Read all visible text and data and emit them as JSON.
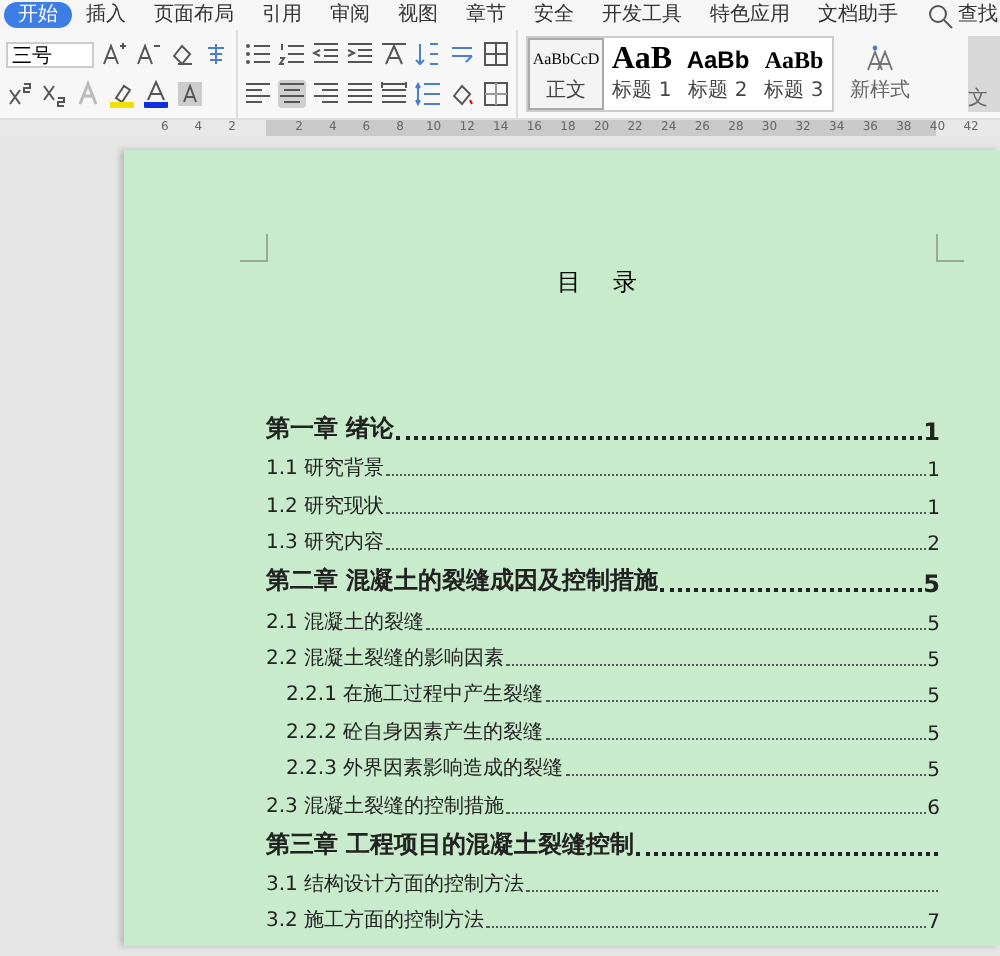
{
  "menu_tabs": [
    {
      "label": "开始",
      "selected": true,
      "kind": "tab"
    },
    {
      "label": "插入",
      "selected": false,
      "kind": "tab"
    },
    {
      "label": "页面布局",
      "selected": false,
      "kind": "tab"
    },
    {
      "label": "引用",
      "selected": false,
      "kind": "tab"
    },
    {
      "label": "审阅",
      "selected": false,
      "kind": "tab"
    },
    {
      "label": "视图",
      "selected": false,
      "kind": "tab"
    },
    {
      "label": "章节",
      "selected": false,
      "kind": "tab"
    },
    {
      "label": "安全",
      "selected": false,
      "kind": "tab"
    },
    {
      "label": "开发工具",
      "selected": false,
      "kind": "tab"
    },
    {
      "label": "特色应用",
      "selected": false,
      "kind": "tab"
    },
    {
      "label": "文档助手",
      "selected": false,
      "kind": "tab"
    },
    {
      "label": "查找",
      "selected": false,
      "kind": "search"
    }
  ],
  "font_size_field": {
    "value": "三号"
  },
  "align_buttons": [
    {
      "selected": false
    },
    {
      "selected": true
    },
    {
      "selected": false
    },
    {
      "selected": false
    },
    {
      "selected": false
    }
  ],
  "style_gallery": [
    {
      "preview": "AaBbCcD",
      "label": "正文",
      "selected": true,
      "kind": "body"
    },
    {
      "preview": "AaB",
      "label": "标题 1",
      "selected": false,
      "kind": "h1"
    },
    {
      "preview": "AaBb",
      "label": "标题 2",
      "selected": false,
      "kind": "h2"
    },
    {
      "preview": "AaBb",
      "label": "标题 3",
      "selected": false,
      "kind": "h3"
    }
  ],
  "new_style_button": {
    "label": "新样式"
  },
  "side_button": {
    "label": "文"
  },
  "ruler": {
    "left_labels": [
      "6",
      "4",
      "2"
    ],
    "labels": [
      "2",
      "4",
      "6",
      "8",
      "10",
      "12",
      "14",
      "16",
      "18",
      "20",
      "22",
      "24",
      "26",
      "28",
      "30",
      "32",
      "34",
      "36",
      "38",
      "40",
      "42"
    ]
  },
  "document": {
    "title": "目 录",
    "entries": [
      {
        "kind": "chapter",
        "title": "第一章  绪论",
        "page": "1"
      },
      {
        "kind": "section",
        "title": "1.1  研究背景",
        "page": "1"
      },
      {
        "kind": "section",
        "title": "1.2  研究现状",
        "page": "1"
      },
      {
        "kind": "section",
        "title": "1.3  研究内容",
        "page": "2"
      },
      {
        "kind": "chapter",
        "title": "第二章  混凝土的裂缝成因及控制措施",
        "page": "5"
      },
      {
        "kind": "section",
        "title": "2.1  混凝土的裂缝",
        "page": "5"
      },
      {
        "kind": "section",
        "title": "2.2  混凝土裂缝的影响因素",
        "page": "5",
        "children": [
          {
            "kind": "subsection",
            "title": "2.2.1 在施工过程中产生裂缝",
            "page": "5"
          },
          {
            "kind": "subsection",
            "title": "2.2.2  砼自身因素产生的裂缝",
            "page": "5"
          },
          {
            "kind": "subsection",
            "title": "2.2.3  外界因素影响造成的裂缝",
            "page": "5"
          }
        ]
      },
      {
        "kind": "section",
        "title": "2.3  混凝土裂缝的控制措施",
        "page": "6"
      },
      {
        "kind": "chapter",
        "title": "第三章  工程项目的混凝土裂缝控制"
      },
      {
        "kind": "section",
        "title": "3.1  结构设计方面的控制方法"
      },
      {
        "kind": "section",
        "title": "3.2  施工方面的控制方法",
        "page": "7"
      }
    ]
  }
}
